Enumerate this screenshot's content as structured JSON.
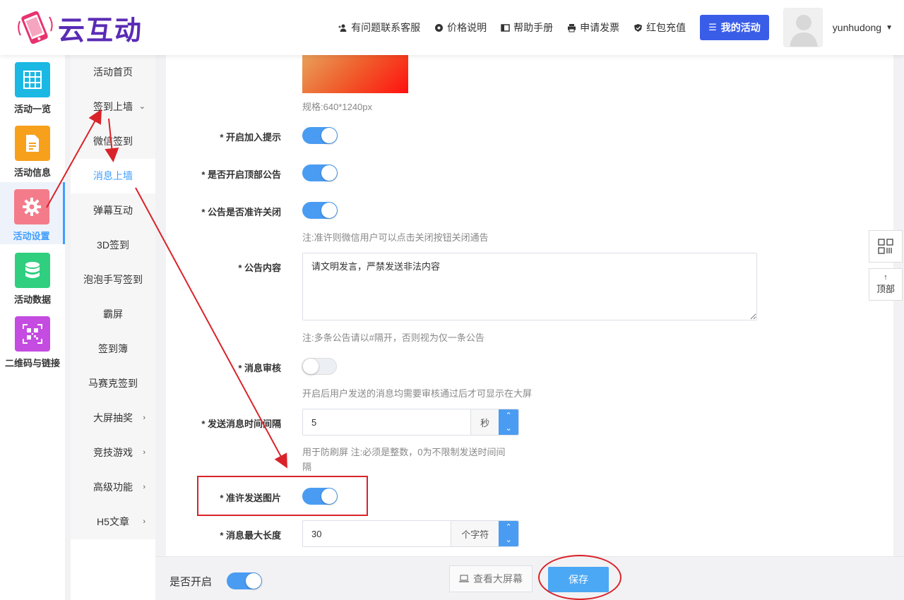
{
  "header": {
    "logo_text": "云互动",
    "nav": [
      {
        "icon": "user-plus-icon",
        "label": "有问题联系客服"
      },
      {
        "icon": "gear-icon",
        "label": "价格说明"
      },
      {
        "icon": "book-icon",
        "label": "帮助手册"
      },
      {
        "icon": "printer-icon",
        "label": "申请发票"
      },
      {
        "icon": "shield-check-icon",
        "label": "红包充值"
      }
    ],
    "my_activity": "我的活动",
    "username": "yunhudong"
  },
  "sidebar": {
    "items": [
      {
        "label": "活动一览",
        "icon": "grid-icon",
        "color": "#1cb8e4"
      },
      {
        "label": "活动信息",
        "icon": "document-icon",
        "color": "#f7a01c"
      },
      {
        "label": "活动设置",
        "icon": "settings-icon",
        "color": "#f47c8a",
        "active": true
      },
      {
        "label": "活动数据",
        "icon": "database-icon",
        "color": "#2fcf7f"
      },
      {
        "label": "二维码与链接",
        "icon": "qrcode-icon",
        "color": "#c44ce0"
      }
    ]
  },
  "submenu": {
    "items": [
      {
        "label": "活动首页",
        "arrow": ""
      },
      {
        "label": "签到上墙",
        "arrow": "⌄"
      },
      {
        "label": "微信签到",
        "arrow": ""
      },
      {
        "label": "消息上墙",
        "arrow": "",
        "active": true
      },
      {
        "label": "弹幕互动",
        "arrow": ""
      },
      {
        "label": "3D签到",
        "arrow": ""
      },
      {
        "label": "泡泡手写签到",
        "arrow": ""
      },
      {
        "label": "霸屏",
        "arrow": ""
      },
      {
        "label": "签到簿",
        "arrow": ""
      },
      {
        "label": "马赛克签到",
        "arrow": ""
      },
      {
        "label": "大屏抽奖",
        "arrow": "›"
      },
      {
        "label": "竞技游戏",
        "arrow": "›"
      },
      {
        "label": "高级功能",
        "arrow": "›"
      },
      {
        "label": "H5文章",
        "arrow": "›"
      }
    ]
  },
  "form": {
    "spec": "规格:640*1240px",
    "join_tip_label": "* 开启加入提示",
    "join_tip_on": true,
    "top_notice_label": "* 是否开启顶部公告",
    "top_notice_on": true,
    "notice_close_label": "* 公告是否准许关闭",
    "notice_close_on": true,
    "notice_close_hint": "注:准许则微信用户可以点击关闭按钮关闭通告",
    "notice_content_label": "* 公告内容",
    "notice_content_value": "请文明发言，严禁发送非法内容",
    "notice_content_hint": "注:多条公告请以#隔开，否则视为仅一条公告",
    "review_label": "* 消息审核",
    "review_on": false,
    "review_hint": "开启后用户发送的消息均需要审核通过后才可显示在大屏",
    "interval_label": "* 发送消息时间间隔",
    "interval_value": "5",
    "interval_unit": "秒",
    "interval_hint": "用于防刷屏 注:必须是整数，0为不限制发送时间间隔",
    "allow_image_label": "* 准许发送图片",
    "allow_image_on": true,
    "maxlen_label": "* 消息最大长度",
    "maxlen_value": "30",
    "maxlen_unit": "个字符"
  },
  "float": {
    "top_label": "顶部"
  },
  "bottom": {
    "enable_label": "是否开启",
    "enable_on": true,
    "view_screen": "查看大屏幕",
    "save": "保存"
  }
}
